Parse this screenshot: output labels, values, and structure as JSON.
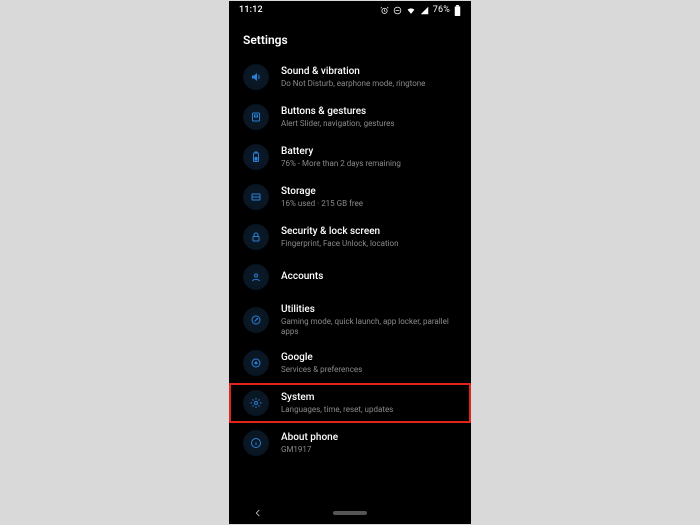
{
  "statusbar": {
    "time": "11:12",
    "battery_pct": "76%"
  },
  "header": {
    "title": "Settings"
  },
  "items": [
    {
      "title": "Sound & vibration",
      "sub": "Do Not Disturb, earphone mode, ringtone"
    },
    {
      "title": "Buttons & gestures",
      "sub": "Alert Slider, navigation, gestures"
    },
    {
      "title": "Battery",
      "sub": "76% - More than 2 days remaining"
    },
    {
      "title": "Storage",
      "sub": "16% used · 215 GB free"
    },
    {
      "title": "Security & lock screen",
      "sub": "Fingerprint, Face Unlock, location"
    },
    {
      "title": "Accounts",
      "sub": ""
    },
    {
      "title": "Utilities",
      "sub": "Gaming mode, quick launch, app locker, parallel apps"
    },
    {
      "title": "Google",
      "sub": "Services & preferences"
    },
    {
      "title": "System",
      "sub": "Languages, time, reset, updates"
    },
    {
      "title": "About phone",
      "sub": "GM1917"
    }
  ],
  "highlight_index": 8
}
